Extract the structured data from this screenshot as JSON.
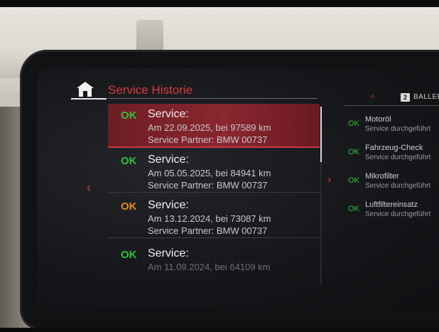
{
  "header": {
    "title": "Service Historie"
  },
  "service_list": [
    {
      "status": "OK",
      "status_color": "#2fc13a",
      "title": "Service:",
      "line1": "Am 22.09.2025, bei 97589 km",
      "line2": "Service Partner: BMW 00737",
      "selected": true
    },
    {
      "status": "OK",
      "status_color": "#2fc13a",
      "title": "Service:",
      "line1": "Am 05.05.2025, bei 84941 km",
      "line2": "Service Partner: BMW 00737",
      "selected": false
    },
    {
      "status": "OK",
      "status_color": "#e48a1a",
      "title": "Service:",
      "line1": "Am 13.12.2024, bei 73087 km",
      "line2": "Service Partner: BMW 00737",
      "selected": false
    },
    {
      "status": "OK",
      "status_color": "#2fc13a",
      "title": "Service:",
      "line1": "Am 11.09.2024, bei 64109 km",
      "line2": "",
      "selected": false
    }
  ],
  "right_panel": {
    "caret": "^",
    "badge": "2",
    "user": "BALLERM",
    "items": [
      {
        "status": "OK",
        "name": "Motoröl",
        "sub": "Service durchgeführt"
      },
      {
        "status": "OK",
        "name": "Fahrzeug-Check",
        "sub": "Service durchgeführt"
      },
      {
        "status": "OK",
        "name": "Mikrofilter",
        "sub": "Service durchgeführt"
      },
      {
        "status": "OK",
        "name": "Luftfiltereinsatz",
        "sub": "Service durchgeführt"
      }
    ]
  },
  "icons": {
    "home": "home-icon",
    "left": "chevron-left-icon",
    "right": "chevron-right-icon"
  },
  "colors": {
    "accent": "#d83a3a",
    "ok": "#2fc13a",
    "warning": "#e48a1a",
    "selected_row": "#8a2730"
  }
}
